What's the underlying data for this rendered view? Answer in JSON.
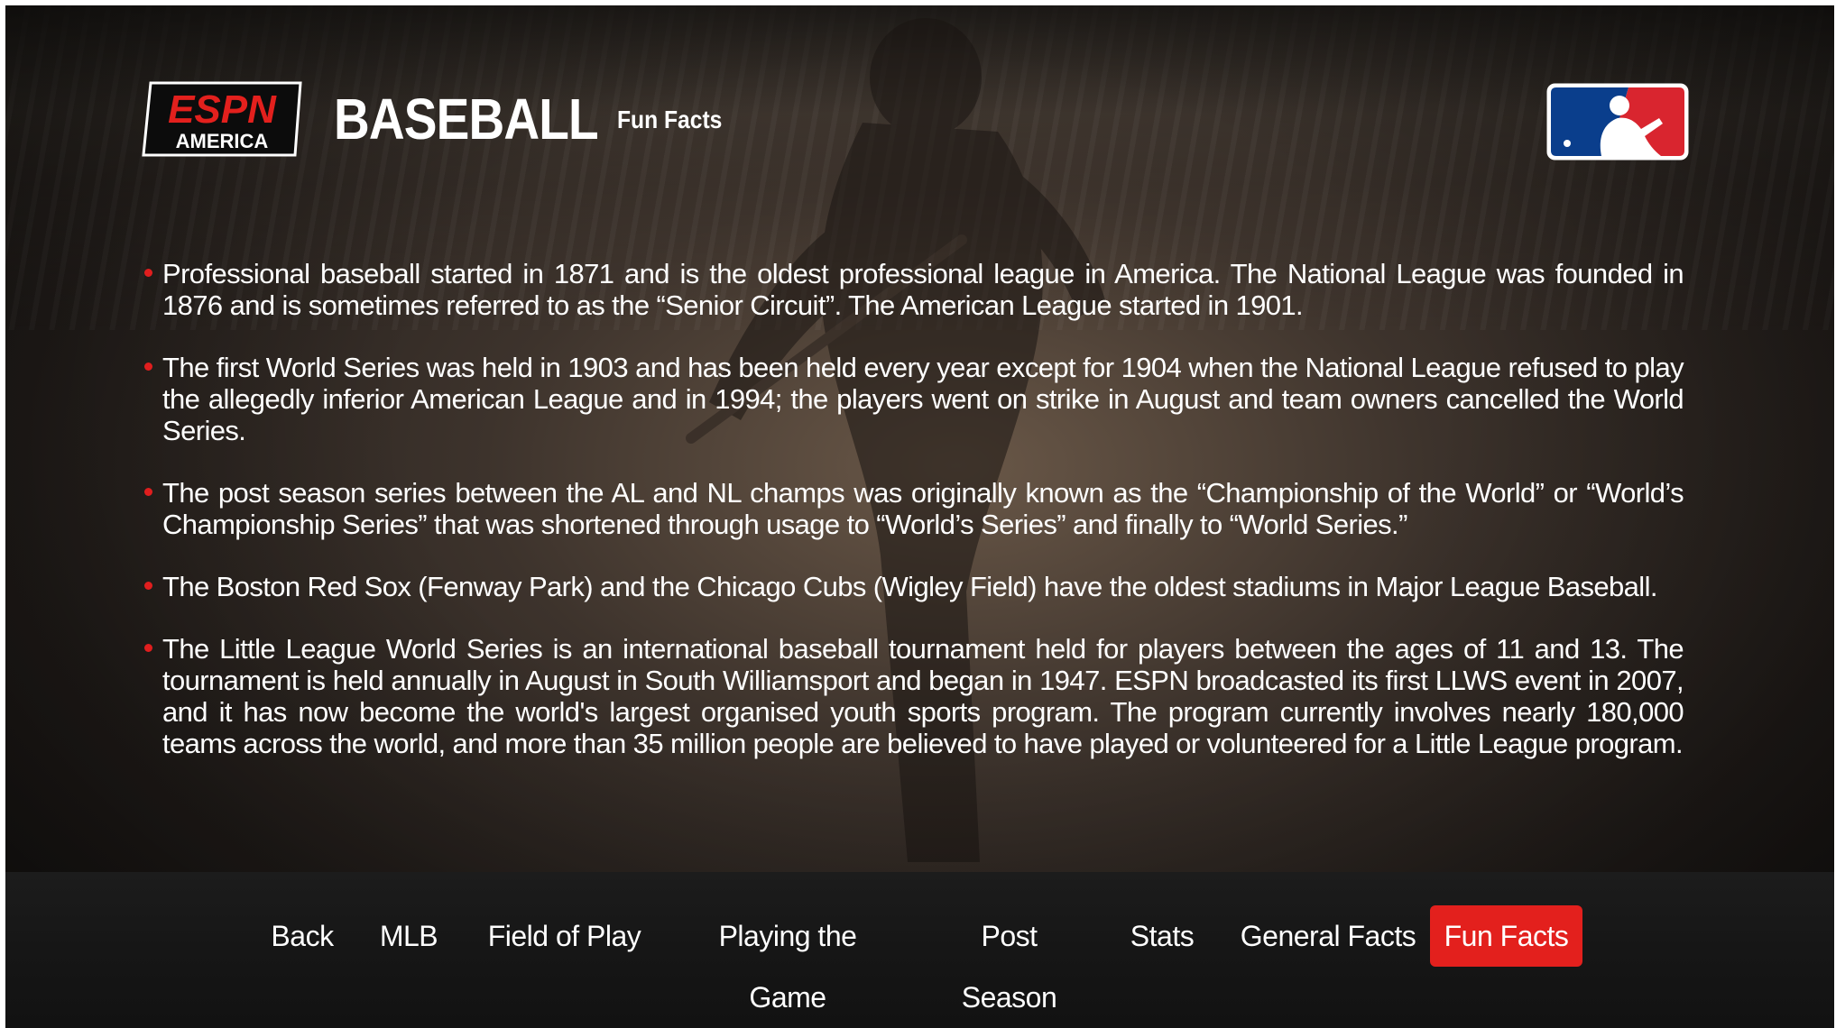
{
  "header": {
    "brand_logo_text": "ESPN",
    "brand_logo_subtext": "AMERICA",
    "title": "BASEBALL",
    "subtitle": "Fun Facts"
  },
  "facts": [
    "Professional baseball started in 1871 and is the oldest professional league in America. The National League was founded in 1876 and is sometimes referred to as the “Senior Circuit”. The American League started in 1901.",
    "The first World Series was held in 1903 and has been held every year except for 1904 when the National League refused to play the allegedly inferior American League and in 1994; the players went on strike in August and team owners cancelled the World Series.",
    "The post season series between the AL and NL champs was originally known as the “Championship of the World” or “World’s Championship Series” that was shortened through usage to “World’s Series” and finally to “World Series.”",
    "The Boston Red Sox (Fenway Park) and the Chicago Cubs (Wigley Field) have the oldest stadiums in Major League Baseball.",
    "The Little League World Series is an international baseball tournament held for players between the ages of 11 and 13. The tournament is held annually in August in South Williamsport and began in 1947.  ESPN broadcasted its first LLWS event in 2007, and it has now become the world's largest organised youth sports program.  The program currently involves nearly 180,000 teams across the world, and more than 35 million people are believed to have played or volunteered for a Little League program."
  ],
  "nav": {
    "items": [
      "Back",
      "MLB",
      "Field of Play",
      "Playing the Game",
      "Post Season",
      "Stats",
      "General Facts",
      "Fun Facts"
    ],
    "active": "Fun Facts"
  },
  "colors": {
    "accent_red": "#e3201d",
    "mlb_blue": "#0a3e8c",
    "mlb_red": "#d9252f"
  }
}
